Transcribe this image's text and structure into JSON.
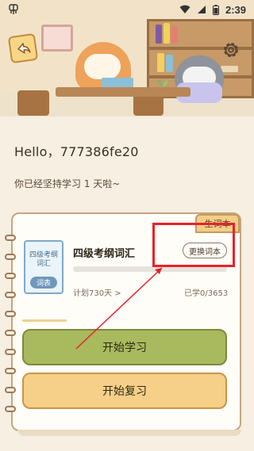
{
  "status_bar": {
    "time": "2:39"
  },
  "greeting": {
    "hello": "Hello，777386fe20",
    "days_text": "你已经坚持学习 1 天啦~"
  },
  "wordbook": {
    "tag": "生词本",
    "cover_title": "四级考纲词汇",
    "cover_tag": "词表",
    "name": "四级考纲词汇",
    "change_label": "更换词本",
    "plan_label": "计划730天 >",
    "learned_label": "已学0/3653",
    "progress_fraction": 0
  },
  "actions": {
    "start_label": "开始学习",
    "review_label": "开始复习"
  },
  "colors": {
    "highlight": "#e8222a",
    "start_btn": "#a9b95d",
    "review_btn": "#f6cf88"
  }
}
